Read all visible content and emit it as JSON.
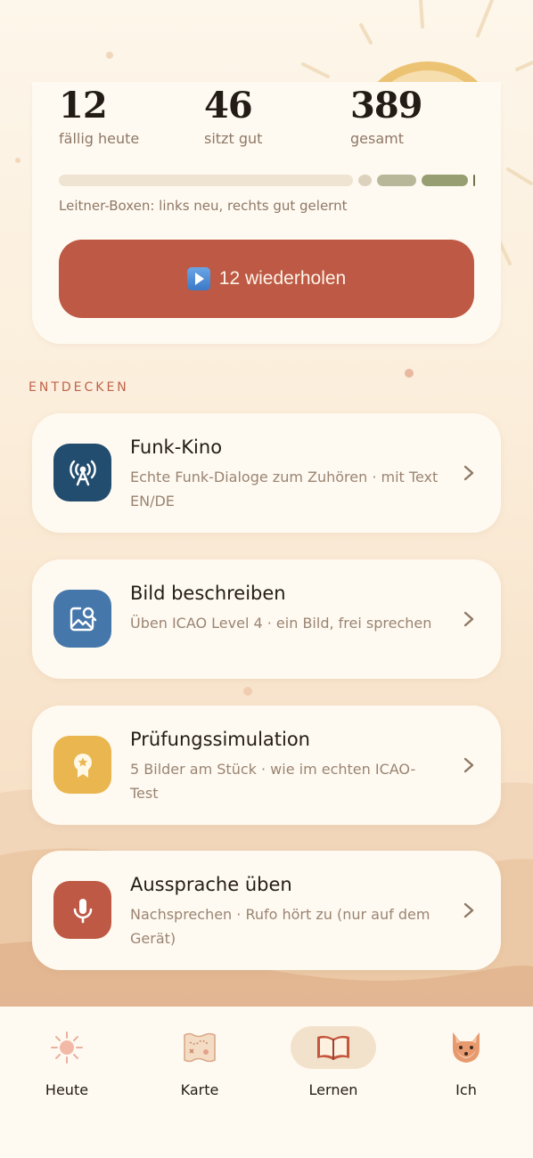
{
  "stats": [
    {
      "value": "12",
      "label": "fällig heute"
    },
    {
      "value": "46",
      "label": "sitzt gut"
    },
    {
      "value": "389",
      "label": "gesamt"
    }
  ],
  "leitner_note": "Leitner-Boxen: links neu, rechts gut gelernt",
  "review_button": "12 wiederholen",
  "section_title": "ENTDECKEN",
  "features": [
    {
      "title": "Funk-Kino",
      "desc": "Echte Funk-Dialoge zum Zuhören · mit Text EN/DE",
      "icon": "radio-tower-icon",
      "color": "#234d6e"
    },
    {
      "title": "Bild beschreiben",
      "desc": "Üben ICAO Level 4 · ein Bild, frei sprechen",
      "icon": "image-search-icon",
      "color": "#4577aa"
    },
    {
      "title": "Prüfungssimulation",
      "desc": "5 Bilder am Stück · wie im echten ICAO-Test",
      "icon": "award-icon",
      "color": "#e9b64f"
    },
    {
      "title": "Aussprache üben",
      "desc": "Nachsprechen · Rufo hört zu (nur auf dem Gerät)",
      "icon": "microphone-icon",
      "color": "#bd5944"
    }
  ],
  "nav": [
    {
      "label": "Heute",
      "icon": "sun-icon",
      "active": false
    },
    {
      "label": "Karte",
      "icon": "map-icon",
      "active": false
    },
    {
      "label": "Lernen",
      "icon": "book-icon",
      "active": true
    },
    {
      "label": "Ich",
      "icon": "fox-avatar-icon",
      "active": false
    }
  ],
  "colors": {
    "accent": "#bd5944",
    "card_bg": "#fffaf1",
    "muted_text": "#8e7866"
  }
}
